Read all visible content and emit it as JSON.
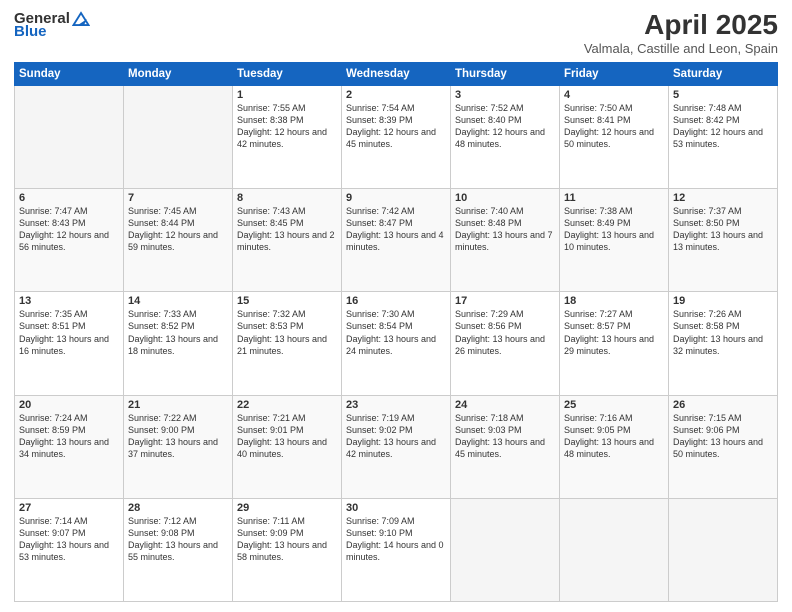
{
  "header": {
    "logo_general": "General",
    "logo_blue": "Blue",
    "title": "April 2025",
    "subtitle": "Valmala, Castille and Leon, Spain"
  },
  "days_of_week": [
    "Sunday",
    "Monday",
    "Tuesday",
    "Wednesday",
    "Thursday",
    "Friday",
    "Saturday"
  ],
  "weeks": [
    [
      {
        "day": "",
        "sunrise": "",
        "sunset": "",
        "daylight": ""
      },
      {
        "day": "",
        "sunrise": "",
        "sunset": "",
        "daylight": ""
      },
      {
        "day": "1",
        "sunrise": "Sunrise: 7:55 AM",
        "sunset": "Sunset: 8:38 PM",
        "daylight": "Daylight: 12 hours and 42 minutes."
      },
      {
        "day": "2",
        "sunrise": "Sunrise: 7:54 AM",
        "sunset": "Sunset: 8:39 PM",
        "daylight": "Daylight: 12 hours and 45 minutes."
      },
      {
        "day": "3",
        "sunrise": "Sunrise: 7:52 AM",
        "sunset": "Sunset: 8:40 PM",
        "daylight": "Daylight: 12 hours and 48 minutes."
      },
      {
        "day": "4",
        "sunrise": "Sunrise: 7:50 AM",
        "sunset": "Sunset: 8:41 PM",
        "daylight": "Daylight: 12 hours and 50 minutes."
      },
      {
        "day": "5",
        "sunrise": "Sunrise: 7:48 AM",
        "sunset": "Sunset: 8:42 PM",
        "daylight": "Daylight: 12 hours and 53 minutes."
      }
    ],
    [
      {
        "day": "6",
        "sunrise": "Sunrise: 7:47 AM",
        "sunset": "Sunset: 8:43 PM",
        "daylight": "Daylight: 12 hours and 56 minutes."
      },
      {
        "day": "7",
        "sunrise": "Sunrise: 7:45 AM",
        "sunset": "Sunset: 8:44 PM",
        "daylight": "Daylight: 12 hours and 59 minutes."
      },
      {
        "day": "8",
        "sunrise": "Sunrise: 7:43 AM",
        "sunset": "Sunset: 8:45 PM",
        "daylight": "Daylight: 13 hours and 2 minutes."
      },
      {
        "day": "9",
        "sunrise": "Sunrise: 7:42 AM",
        "sunset": "Sunset: 8:47 PM",
        "daylight": "Daylight: 13 hours and 4 minutes."
      },
      {
        "day": "10",
        "sunrise": "Sunrise: 7:40 AM",
        "sunset": "Sunset: 8:48 PM",
        "daylight": "Daylight: 13 hours and 7 minutes."
      },
      {
        "day": "11",
        "sunrise": "Sunrise: 7:38 AM",
        "sunset": "Sunset: 8:49 PM",
        "daylight": "Daylight: 13 hours and 10 minutes."
      },
      {
        "day": "12",
        "sunrise": "Sunrise: 7:37 AM",
        "sunset": "Sunset: 8:50 PM",
        "daylight": "Daylight: 13 hours and 13 minutes."
      }
    ],
    [
      {
        "day": "13",
        "sunrise": "Sunrise: 7:35 AM",
        "sunset": "Sunset: 8:51 PM",
        "daylight": "Daylight: 13 hours and 16 minutes."
      },
      {
        "day": "14",
        "sunrise": "Sunrise: 7:33 AM",
        "sunset": "Sunset: 8:52 PM",
        "daylight": "Daylight: 13 hours and 18 minutes."
      },
      {
        "day": "15",
        "sunrise": "Sunrise: 7:32 AM",
        "sunset": "Sunset: 8:53 PM",
        "daylight": "Daylight: 13 hours and 21 minutes."
      },
      {
        "day": "16",
        "sunrise": "Sunrise: 7:30 AM",
        "sunset": "Sunset: 8:54 PM",
        "daylight": "Daylight: 13 hours and 24 minutes."
      },
      {
        "day": "17",
        "sunrise": "Sunrise: 7:29 AM",
        "sunset": "Sunset: 8:56 PM",
        "daylight": "Daylight: 13 hours and 26 minutes."
      },
      {
        "day": "18",
        "sunrise": "Sunrise: 7:27 AM",
        "sunset": "Sunset: 8:57 PM",
        "daylight": "Daylight: 13 hours and 29 minutes."
      },
      {
        "day": "19",
        "sunrise": "Sunrise: 7:26 AM",
        "sunset": "Sunset: 8:58 PM",
        "daylight": "Daylight: 13 hours and 32 minutes."
      }
    ],
    [
      {
        "day": "20",
        "sunrise": "Sunrise: 7:24 AM",
        "sunset": "Sunset: 8:59 PM",
        "daylight": "Daylight: 13 hours and 34 minutes."
      },
      {
        "day": "21",
        "sunrise": "Sunrise: 7:22 AM",
        "sunset": "Sunset: 9:00 PM",
        "daylight": "Daylight: 13 hours and 37 minutes."
      },
      {
        "day": "22",
        "sunrise": "Sunrise: 7:21 AM",
        "sunset": "Sunset: 9:01 PM",
        "daylight": "Daylight: 13 hours and 40 minutes."
      },
      {
        "day": "23",
        "sunrise": "Sunrise: 7:19 AM",
        "sunset": "Sunset: 9:02 PM",
        "daylight": "Daylight: 13 hours and 42 minutes."
      },
      {
        "day": "24",
        "sunrise": "Sunrise: 7:18 AM",
        "sunset": "Sunset: 9:03 PM",
        "daylight": "Daylight: 13 hours and 45 minutes."
      },
      {
        "day": "25",
        "sunrise": "Sunrise: 7:16 AM",
        "sunset": "Sunset: 9:05 PM",
        "daylight": "Daylight: 13 hours and 48 minutes."
      },
      {
        "day": "26",
        "sunrise": "Sunrise: 7:15 AM",
        "sunset": "Sunset: 9:06 PM",
        "daylight": "Daylight: 13 hours and 50 minutes."
      }
    ],
    [
      {
        "day": "27",
        "sunrise": "Sunrise: 7:14 AM",
        "sunset": "Sunset: 9:07 PM",
        "daylight": "Daylight: 13 hours and 53 minutes."
      },
      {
        "day": "28",
        "sunrise": "Sunrise: 7:12 AM",
        "sunset": "Sunset: 9:08 PM",
        "daylight": "Daylight: 13 hours and 55 minutes."
      },
      {
        "day": "29",
        "sunrise": "Sunrise: 7:11 AM",
        "sunset": "Sunset: 9:09 PM",
        "daylight": "Daylight: 13 hours and 58 minutes."
      },
      {
        "day": "30",
        "sunrise": "Sunrise: 7:09 AM",
        "sunset": "Sunset: 9:10 PM",
        "daylight": "Daylight: 14 hours and 0 minutes."
      },
      {
        "day": "",
        "sunrise": "",
        "sunset": "",
        "daylight": ""
      },
      {
        "day": "",
        "sunrise": "",
        "sunset": "",
        "daylight": ""
      },
      {
        "day": "",
        "sunrise": "",
        "sunset": "",
        "daylight": ""
      }
    ]
  ]
}
